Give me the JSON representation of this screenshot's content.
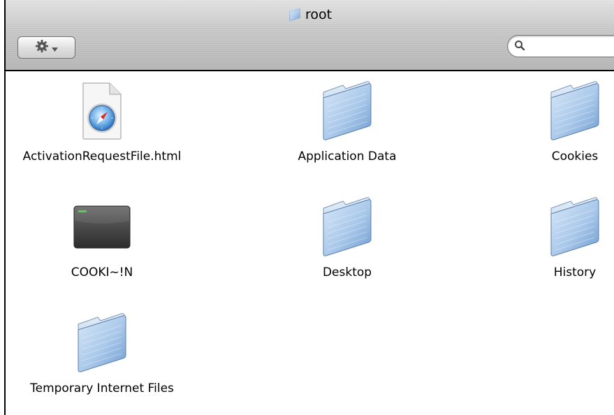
{
  "window": {
    "title": "root"
  },
  "toolbar": {
    "action_icon": "gear-icon",
    "search_placeholder": ""
  },
  "items": [
    {
      "label": "ActivationRequestFile.html",
      "icon": "html-document-icon"
    },
    {
      "label": "Application Data",
      "icon": "folder-icon"
    },
    {
      "label": "Cookies",
      "icon": "folder-icon"
    },
    {
      "label": "COOKI~!N",
      "icon": "exec-file-icon"
    },
    {
      "label": "Desktop",
      "icon": "folder-icon"
    },
    {
      "label": "History",
      "icon": "folder-icon"
    },
    {
      "label": "Temporary Internet Files",
      "icon": "folder-icon"
    }
  ]
}
